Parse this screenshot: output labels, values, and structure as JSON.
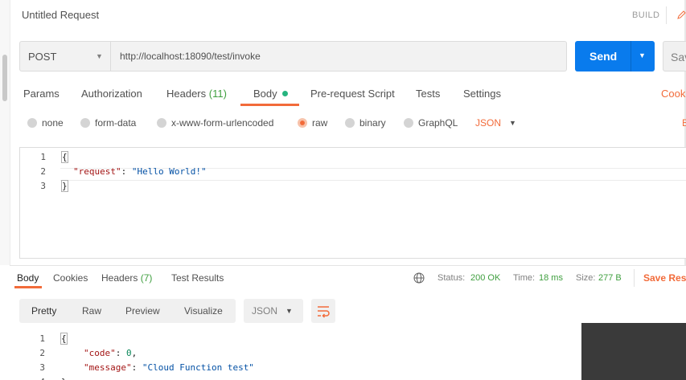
{
  "header": {
    "title": "Untitled Request",
    "build_label": "BUILD"
  },
  "request": {
    "method": "POST",
    "url": "http://localhost:18090/test/invoke",
    "send_label": "Send",
    "save_label": "Sav"
  },
  "request_tabs": [
    {
      "label": "Params"
    },
    {
      "label": "Authorization"
    },
    {
      "label": "Headers",
      "count": "(11)"
    },
    {
      "label": "Body",
      "active": true
    },
    {
      "label": "Pre-request Script"
    },
    {
      "label": "Tests"
    },
    {
      "label": "Settings"
    }
  ],
  "cookies_link": "Cooki",
  "body_types": [
    {
      "label": "none",
      "checked": false
    },
    {
      "label": "form-data",
      "checked": false
    },
    {
      "label": "x-www-form-urlencoded",
      "checked": false
    },
    {
      "label": "raw",
      "checked": true
    },
    {
      "label": "binary",
      "checked": false
    },
    {
      "label": "GraphQL",
      "checked": false
    }
  ],
  "body_format": "JSON",
  "beautify_link": "B",
  "request_editor": {
    "line_numbers": [
      "1",
      "2",
      "3"
    ],
    "open_brace": "{",
    "key": "\"request\"",
    "colon": ": ",
    "value": "\"Hello World!\"",
    "close_brace": "}"
  },
  "response_tabs": [
    {
      "label": "Body",
      "active": true
    },
    {
      "label": "Cookies"
    },
    {
      "label": "Headers",
      "count": "(7)"
    },
    {
      "label": "Test Results"
    }
  ],
  "response_status": {
    "status_label": "Status:",
    "status_value": "200 OK",
    "time_label": "Time:",
    "time_value": "18 ms",
    "size_label": "Size:",
    "size_value": "277 B",
    "save_response": "Save Resp"
  },
  "response_views": [
    "Pretty",
    "Raw",
    "Preview",
    "Visualize"
  ],
  "response_format": "JSON",
  "response_editor": {
    "line_numbers": [
      "1",
      "2",
      "3",
      "4"
    ],
    "open_brace": "{",
    "code_key": "\"code\"",
    "code_sep": ": ",
    "code_value": "0",
    "comma": ",",
    "message_key": "\"message\"",
    "message_sep": ": ",
    "message_value": "\"Cloud Function test\"",
    "close_brace": "}"
  },
  "colors": {
    "accent": "#f26b3a",
    "send_button": "#097bed",
    "status_ok": "#3f9f3f",
    "body_dot": "#26b47f"
  },
  "icons": [
    "edit-icon",
    "globe-icon",
    "wrap-lines-icon",
    "caret-down-icon"
  ]
}
